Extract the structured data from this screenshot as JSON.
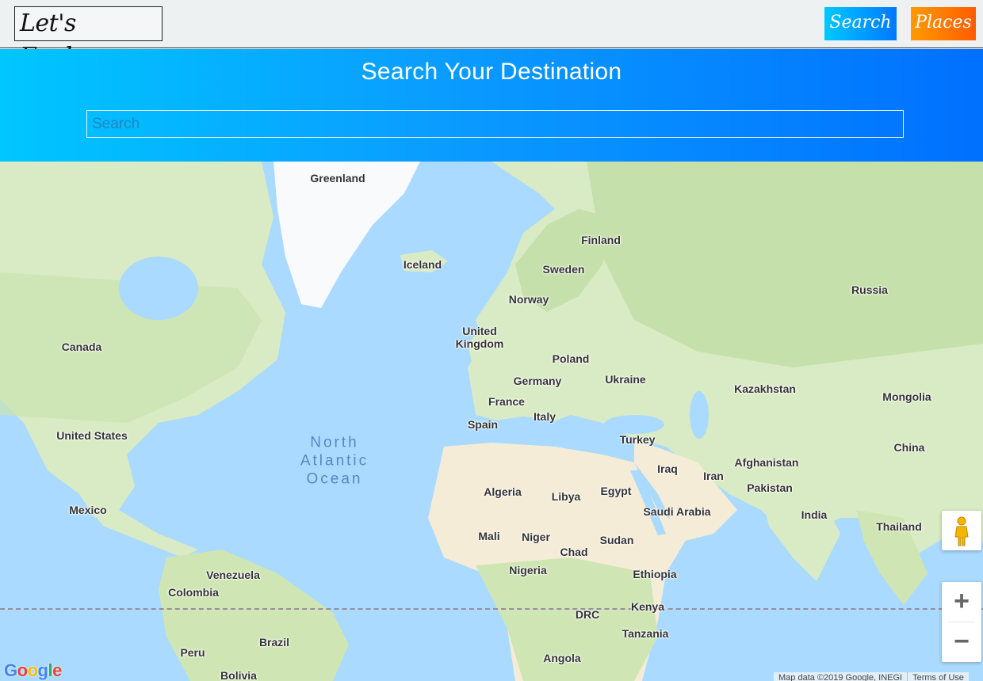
{
  "header": {
    "brand": "Let's Explore",
    "nav": {
      "search": "Search",
      "places": "Places"
    }
  },
  "hero": {
    "title": "Search Your Destination",
    "search_placeholder": "Search"
  },
  "map": {
    "countries": [
      "Greenland",
      "Iceland",
      "Finland",
      "Sweden",
      "Norway",
      "Russia",
      "Canada",
      "United Kingdom",
      "Poland",
      "Germany",
      "Ukraine",
      "Kazakhstan",
      "Mongolia",
      "France",
      "Italy",
      "Spain",
      "Turkey",
      "United States",
      "China",
      "Afghanistan",
      "Iraq",
      "Iran",
      "Pakistan",
      "Algeria",
      "Libya",
      "Egypt",
      "Saudi Arabia",
      "India",
      "Mexico",
      "Mali",
      "Niger",
      "Chad",
      "Sudan",
      "Thailand",
      "Venezuela",
      "Nigeria",
      "Ethiopia",
      "Colombia",
      "DRC",
      "Kenya",
      "Brazil",
      "Tanzania",
      "Peru",
      "Angola",
      "Bolivia"
    ],
    "ocean": "North\nAtlantic\nOcean",
    "zoom_in": "+",
    "zoom_out": "−",
    "google_logo": "Google",
    "attribution_data": "Map data ©2019 Google, INEGI",
    "attribution_terms": "Terms of Use"
  },
  "colors": {
    "water": "#aadaff",
    "land": "#d9ebc4",
    "forest": "#b9d9a4",
    "desert": "#f5ecd7",
    "ice": "#f8fafc",
    "search_btn": "#0090ff",
    "places_btn": "#ff7a00"
  }
}
